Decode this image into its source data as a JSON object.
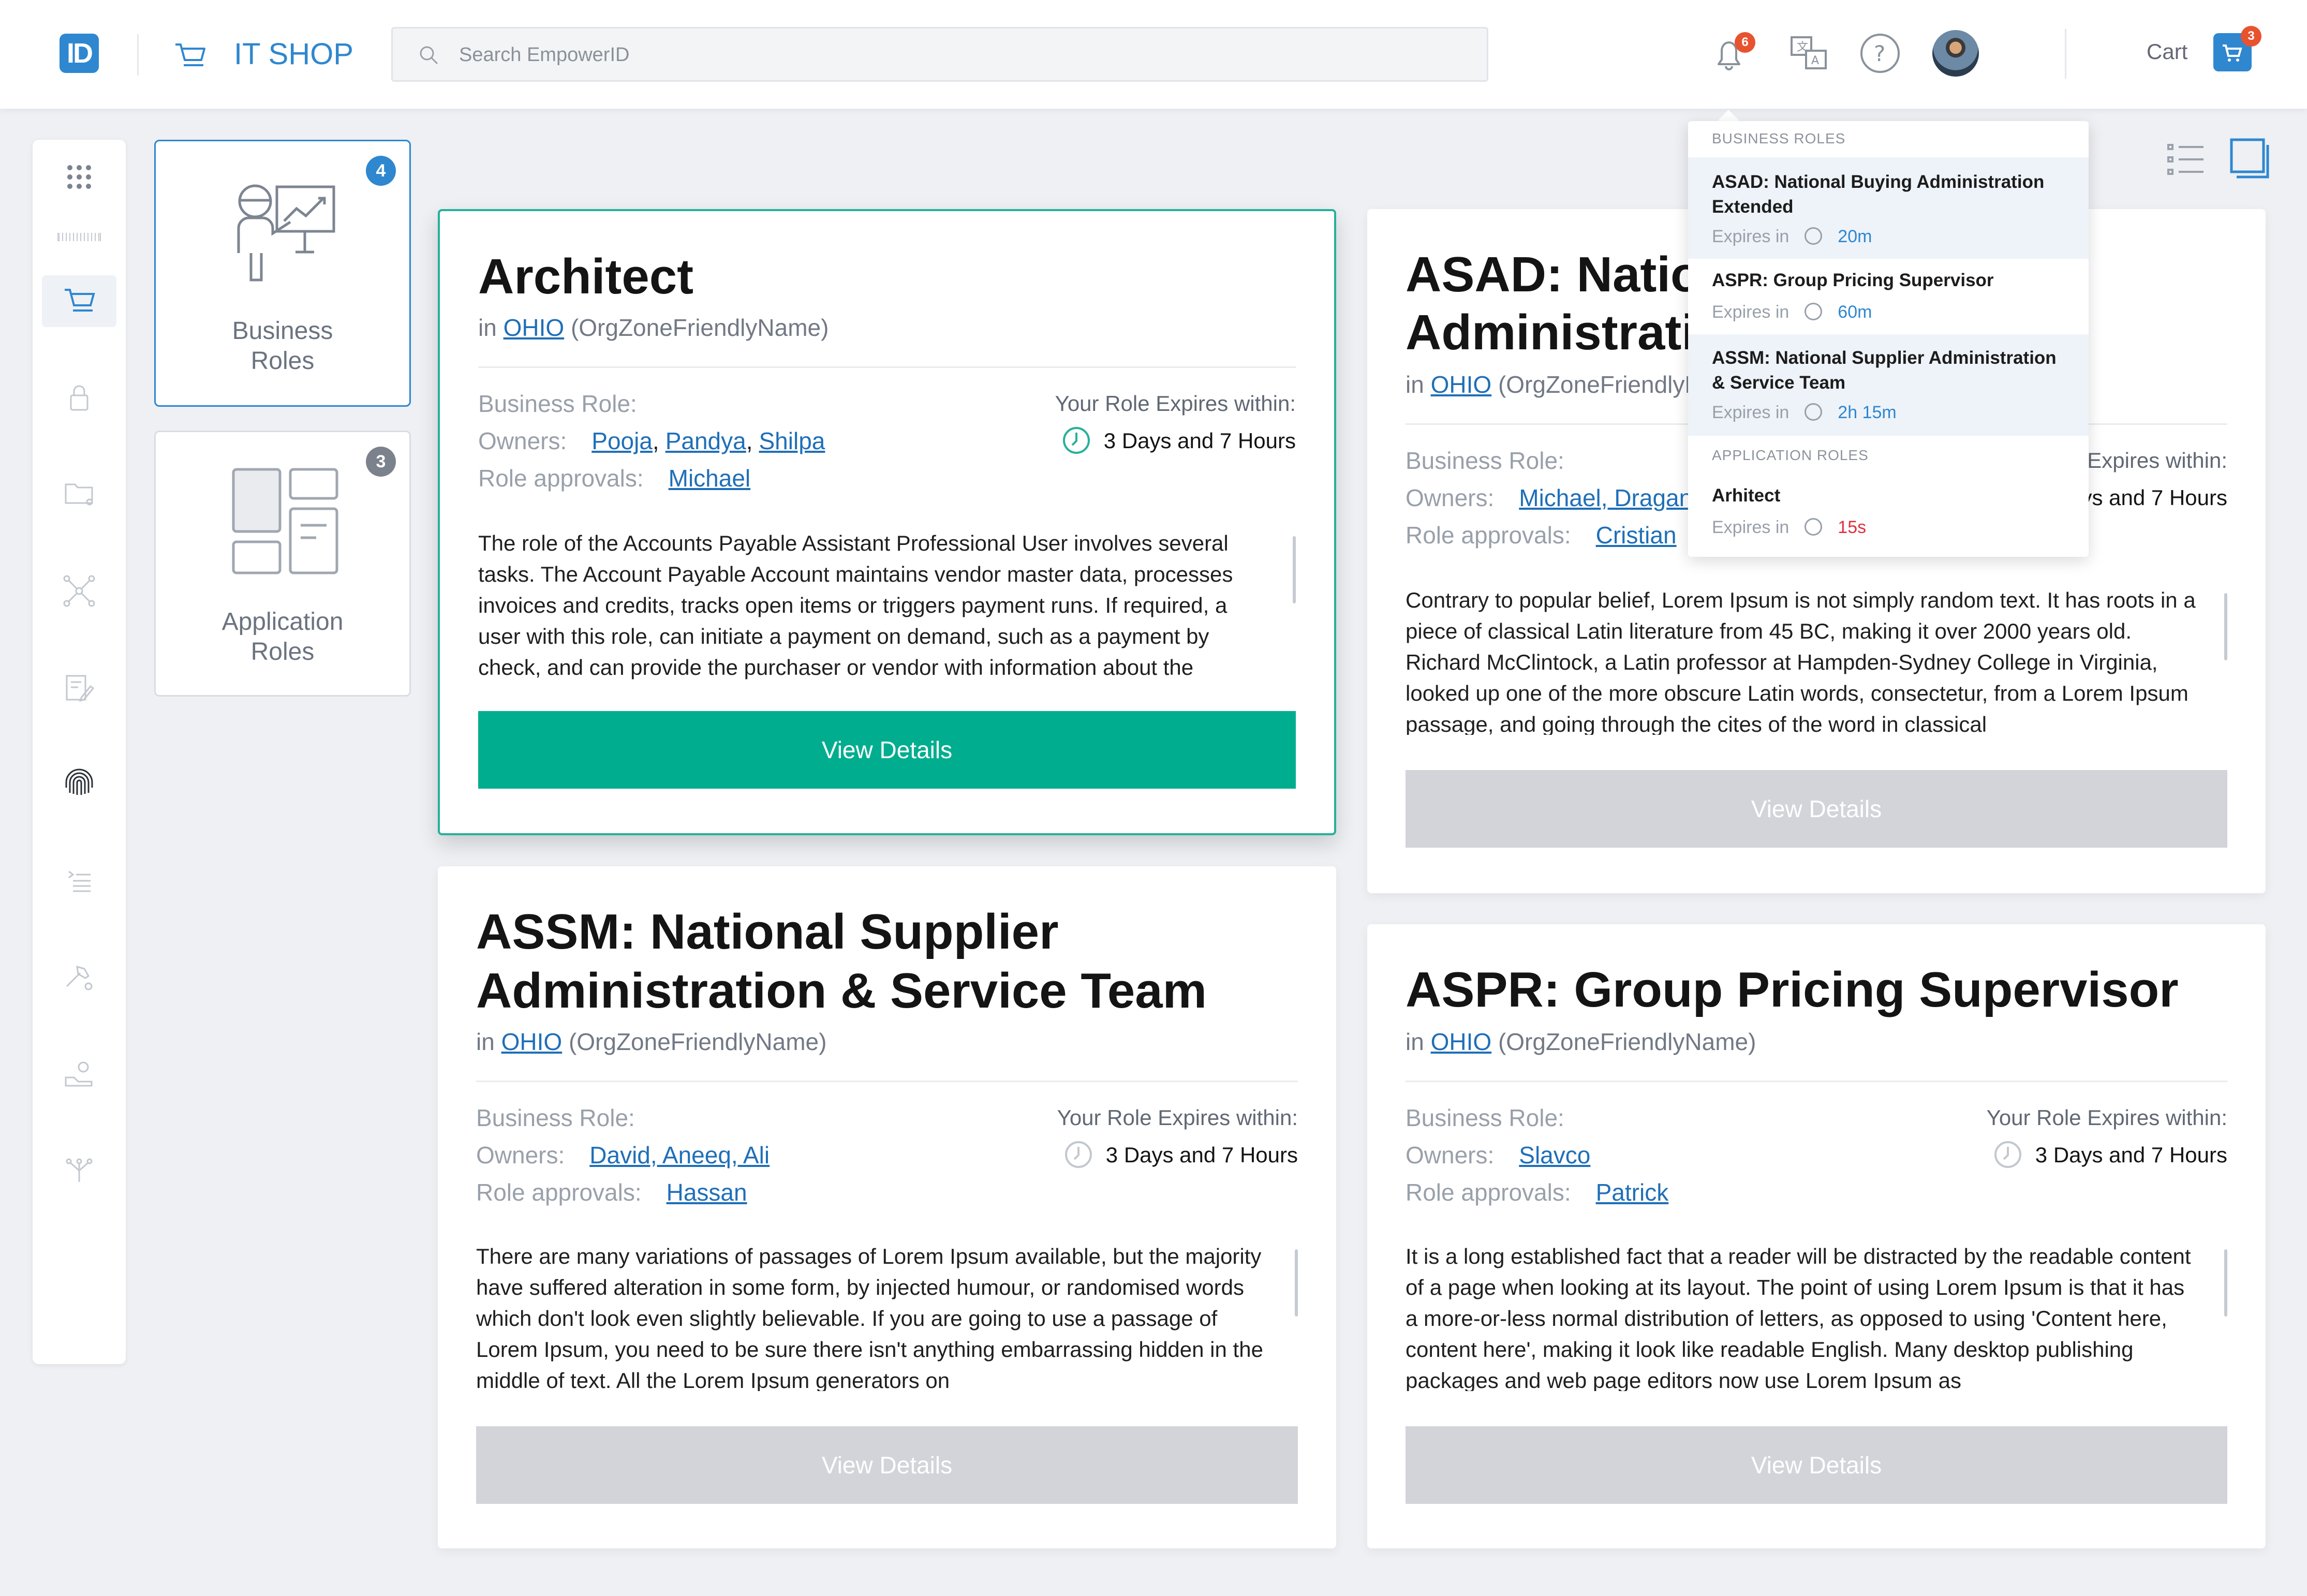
{
  "header": {
    "logo": "ID",
    "app_title": "IT SHOP",
    "search_placeholder": "Search EmpowerID",
    "notifications_count": "6",
    "cart_label": "Cart",
    "cart_count": "3"
  },
  "tiles": [
    {
      "label_line1": "Business",
      "label_line2": "Roles",
      "count": "4"
    },
    {
      "label_line1": "Application",
      "label_line2": "Roles",
      "count": "3"
    }
  ],
  "cards": [
    {
      "title_line1": "Architect",
      "title_line2": "",
      "in_label": "in",
      "org": "OHIO",
      "org_suffix": "(OrgZoneFriendlyName)",
      "role_label": "Business Role:",
      "owners_label": "Owners:",
      "owners": [
        "Pooja",
        "Pandya",
        "Shilpa"
      ],
      "approvals_label": "Role approvals:",
      "approvals": "Michael",
      "expires_label": "Your Role Expires within:",
      "expires_value": "3 Days and 7 Hours",
      "description": "The role of the Accounts Payable Assistant Professional User involves several tasks. The Account Payable Account maintains vendor master data, processes invoices and credits, tracks open items or triggers payment runs. If required, a user with this role, can initiate a payment on demand, such as a payment by check, and can provide the purchaser or vendor with information about the",
      "button": "View Details"
    },
    {
      "title_line1": "ASAD: National Buying",
      "title_line2": "Administration Extended",
      "in_label": "in",
      "org": "OHIO",
      "org_suffix": "(OrgZoneFriendlyName)",
      "role_label": "Business Role:",
      "owners_label": "Owners:",
      "owners_text": "Michael, Dragan",
      "approvals_label": "Role approvals:",
      "approvals": "Cristian",
      "expires_label": "Your Role Expires within:",
      "expires_value": "3 Days and 7 Hours",
      "description": "Contrary to popular belief, Lorem Ipsum is not simply random text. It has roots in a piece of classical Latin literature from 45 BC, making it over 2000 years old. Richard McClintock, a Latin professor at Hampden-Sydney College in Virginia, looked up one of the more obscure Latin words, consectetur, from a Lorem Ipsum passage, and going through the cites of the word in classical",
      "button": "View Details"
    },
    {
      "title_line1": "ASSM: National Supplier",
      "title_line2": "Administration & Service Team",
      "in_label": "in",
      "org": "OHIO",
      "org_suffix": "(OrgZoneFriendlyName)",
      "role_label": "Business Role:",
      "owners_label": "Owners:",
      "owners_text": "David, Aneeq, Ali",
      "approvals_label": "Role approvals:",
      "approvals": "Hassan",
      "expires_label": "Your Role Expires within:",
      "expires_value": "3 Days and 7 Hours",
      "description": "There are many variations of passages of Lorem Ipsum available, but the majority have suffered alteration in some form, by injected humour, or randomised words which don't look even slightly believable. If you are going to use a passage of Lorem Ipsum, you need to be sure there isn't anything embarrassing hidden in the middle of text. All the Lorem Ipsum generators on",
      "button": "View Details"
    },
    {
      "title_line1": "ASPR: Group Pricing Supervisor",
      "title_line2": "",
      "in_label": "in",
      "org": "OHIO",
      "org_suffix": "(OrgZoneFriendlyName)",
      "role_label": "Business Role:",
      "owners_label": "Owners:",
      "owners_text": "Slavco",
      "approvals_label": "Role approvals:",
      "approvals": "Patrick",
      "expires_label": "Your Role Expires within:",
      "expires_value": "3 Days and 7 Hours",
      "description": "It is a long established fact that a reader will be distracted by the readable content of a page when looking at its layout. The point of using Lorem Ipsum is that it has a more-or-less normal distribution of letters, as opposed to using 'Content here, content here', making it look like readable English. Many desktop publishing packages and web page editors now use Lorem Ipsum as",
      "button": "View Details"
    }
  ],
  "dropdown": {
    "business_header": "BUSINESS ROLES",
    "app_header": "APPLICATION ROLES",
    "expires_in": "Expires in",
    "items": [
      {
        "title": "ASAD: National Buying Administration Extended",
        "time": "20m"
      },
      {
        "title": "ASPR: Group Pricing Supervisor",
        "time": "60m"
      },
      {
        "title": "ASSM: National Supplier Administration & Service Team",
        "time": "2h 15m"
      },
      {
        "title": "Arhitect",
        "time": "15s"
      }
    ]
  },
  "colors": {
    "brand_blue": "#2f87d0",
    "accent_green": "#00ae8f",
    "disabled_button": "#d2d4d9",
    "alert_red": "#e8532f"
  }
}
